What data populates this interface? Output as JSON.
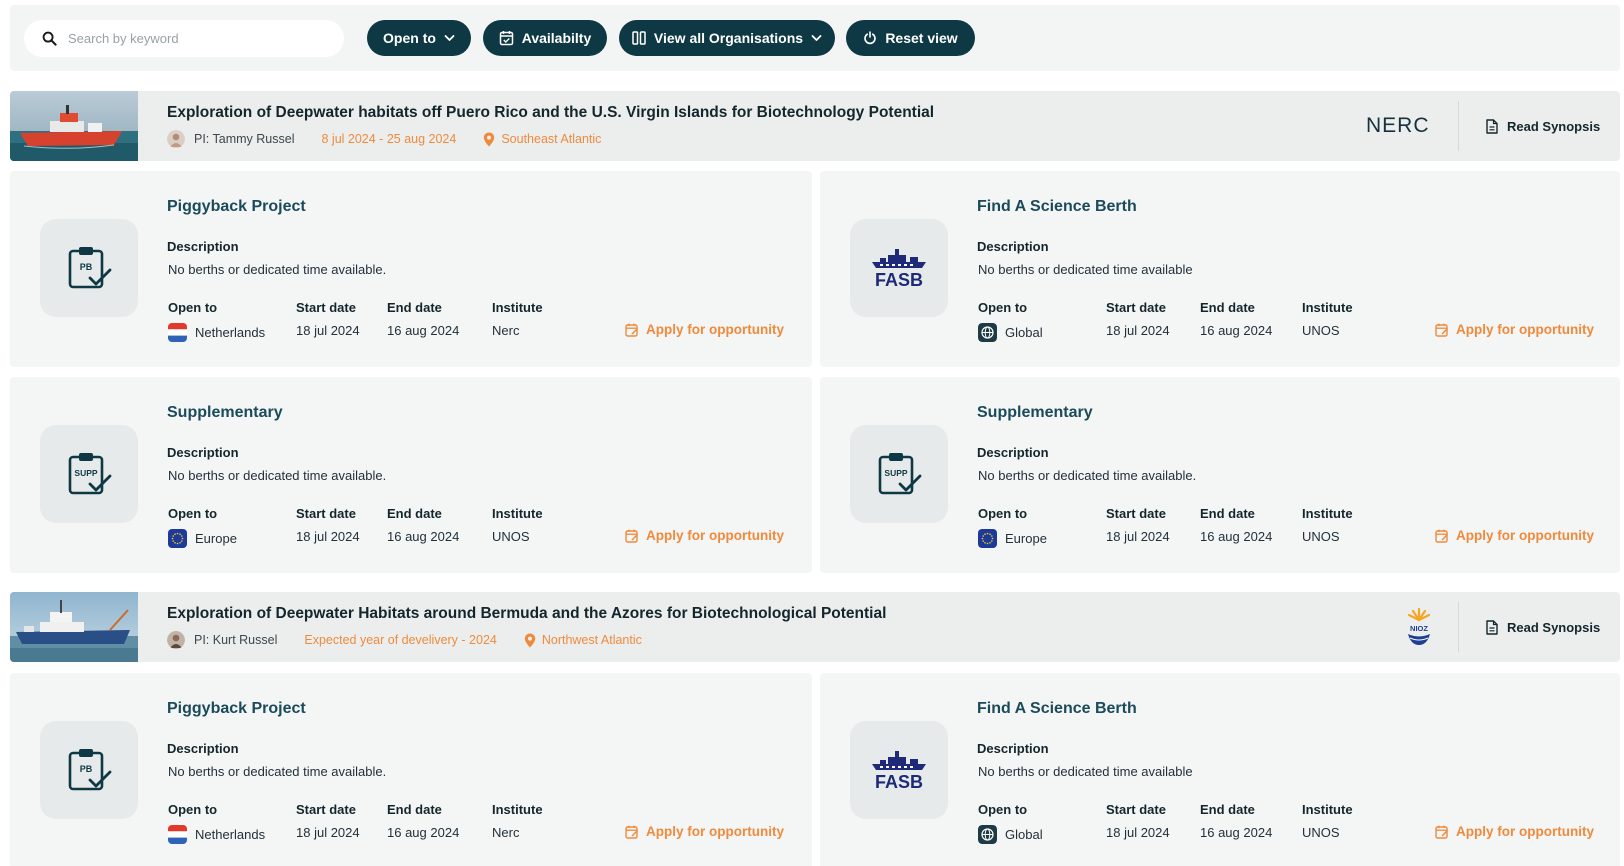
{
  "toolbar": {
    "search_placeholder": "Search by keyword",
    "open_to_label": "Open to",
    "availability_label": "Availabilty",
    "organisations_label": "View all Organisations",
    "reset_label": "Reset view"
  },
  "projects": [
    {
      "title": "Exploration of Deepwater habitats off Puero Rico and the U.S. Virgin Islands for Biotechnology Potential",
      "pi": "PI: Tammy Russel",
      "dates": "8 jul 2024 - 25 aug 2024",
      "location": "Southeast Atlantic",
      "org_logo_text": "NERC",
      "synopsis_label": "Read Synopsis",
      "opportunities": [
        {
          "title": "Piggyback Project",
          "icon_text": "PB",
          "description_label": "Description",
          "description": "No berths or dedicated time available.",
          "open_to_label": "Open to",
          "open_to": "Netherlands",
          "start_label": "Start date",
          "start": "18 jul 2024",
          "end_label": "End date",
          "end": "16 aug 2024",
          "institute_label": "Institute",
          "institute": "Nerc",
          "apply_label": "Apply for opportunity"
        },
        {
          "title": "Find A Science Berth",
          "icon_text": "FASB",
          "description_label": "Description",
          "description": "No berths or dedicated time available",
          "open_to_label": "Open to",
          "open_to": "Global",
          "start_label": "Start date",
          "start": "18 jul 2024",
          "end_label": "End date",
          "end": "16 aug 2024",
          "institute_label": "Institute",
          "institute": "UNOS",
          "apply_label": "Apply for opportunity"
        },
        {
          "title": "Supplementary",
          "icon_text": "SUPP",
          "description_label": "Description",
          "description": "No berths or dedicated time available.",
          "open_to_label": "Open to",
          "open_to": "Europe",
          "start_label": "Start date",
          "start": "18 jul 2024",
          "end_label": "End date",
          "end": "16 aug 2024",
          "institute_label": "Institute",
          "institute": "UNOS",
          "apply_label": "Apply for opportunity"
        },
        {
          "title": "Supplementary",
          "icon_text": "SUPP",
          "description_label": "Description",
          "description": "No berths or dedicated time available.",
          "open_to_label": "Open to",
          "open_to": "Europe",
          "start_label": "Start date",
          "start": "18 jul 2024",
          "end_label": "End date",
          "end": "16 aug 2024",
          "institute_label": "Institute",
          "institute": "UNOS",
          "apply_label": "Apply for opportunity"
        }
      ]
    },
    {
      "title": "Exploration of Deepwater Habitats around Bermuda and the Azores for Biotechnological Potential",
      "pi": "PI: Kurt Russel",
      "dates": "Expected year of develivery  - 2024",
      "location": "Northwest Atlantic",
      "org_logo_text": "NIOZ",
      "synopsis_label": "Read Synopsis",
      "opportunities": [
        {
          "title": "Piggyback Project",
          "icon_text": "PB",
          "description_label": "Description",
          "description": "No berths or dedicated time available.",
          "open_to_label": "Open to",
          "open_to": "Netherlands",
          "start_label": "Start date",
          "start": "18 jul 2024",
          "end_label": "End date",
          "end": "16 aug 2024",
          "institute_label": "Institute",
          "institute": "Nerc",
          "apply_label": "Apply for opportunity"
        },
        {
          "title": "Find A Science Berth",
          "icon_text": "FASB",
          "description_label": "Description",
          "description": "No berths or dedicated time available",
          "open_to_label": "Open to",
          "open_to": "Global",
          "start_label": "Start date",
          "start": "18 jul 2024",
          "end_label": "End date",
          "end": "16 aug 2024",
          "institute_label": "Institute",
          "institute": "UNOS",
          "apply_label": "Apply for opportunity"
        }
      ]
    }
  ],
  "colors": {
    "accent": "#ef8a3c",
    "primary": "#0e3944",
    "title_blue": "#1b4a5a",
    "fasb_navy": "#1e2a78"
  }
}
